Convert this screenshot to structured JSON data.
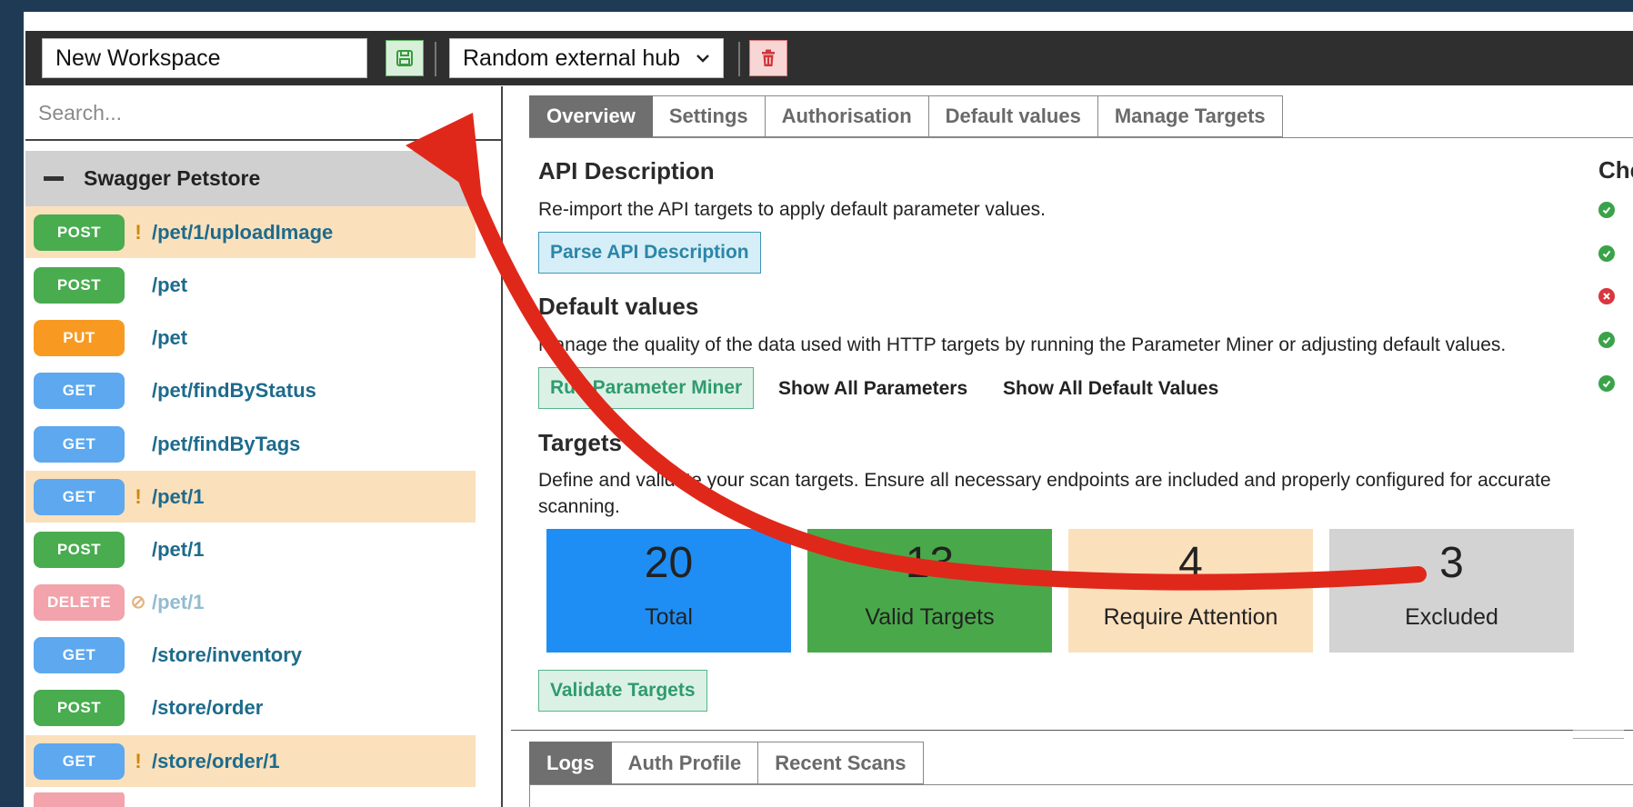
{
  "toolbar": {
    "workspace_name": "New Workspace",
    "hub_selected": "Random external hub"
  },
  "sidebar": {
    "search_placeholder": "Search...",
    "group_title": "Swagger Petstore",
    "endpoints": [
      {
        "method": "POST",
        "path": "/pet/1/uploadImage",
        "flag": "!"
      },
      {
        "method": "POST",
        "path": "/pet",
        "flag": ""
      },
      {
        "method": "PUT",
        "path": "/pet",
        "flag": ""
      },
      {
        "method": "GET",
        "path": "/pet/findByStatus",
        "flag": ""
      },
      {
        "method": "GET",
        "path": "/pet/findByTags",
        "flag": ""
      },
      {
        "method": "GET",
        "path": "/pet/1",
        "flag": "!"
      },
      {
        "method": "POST",
        "path": "/pet/1",
        "flag": ""
      },
      {
        "method": "DELETE",
        "path": "/pet/1",
        "flag": "⊘"
      },
      {
        "method": "GET",
        "path": "/store/inventory",
        "flag": ""
      },
      {
        "method": "POST",
        "path": "/store/order",
        "flag": ""
      },
      {
        "method": "GET",
        "path": "/store/order/1",
        "flag": "!"
      }
    ]
  },
  "tabs": [
    "Overview",
    "Settings",
    "Authorisation",
    "Default values",
    "Manage Targets"
  ],
  "api_description": {
    "heading": "API Description",
    "text": "Re-import the API targets to apply default parameter values.",
    "button": "Parse API Description"
  },
  "default_values": {
    "heading": "Default values",
    "text": "Manage the quality of the data used with HTTP targets by running the Parameter Miner or adjusting default values.",
    "button": "Run Parameter Miner",
    "link_params": "Show All Parameters",
    "link_defaults": "Show All Default Values"
  },
  "targets": {
    "heading": "Targets",
    "text": "Define and validate your scan targets. Ensure all necessary endpoints are included and properly configured for accurate scanning.",
    "stats": [
      {
        "value": "20",
        "label": "Total"
      },
      {
        "value": "13",
        "label": "Valid Targets"
      },
      {
        "value": "4",
        "label": "Require Attention"
      },
      {
        "value": "3",
        "label": "Excluded"
      }
    ],
    "validate_button": "Validate Targets"
  },
  "checks": {
    "title": "Che",
    "statuses": [
      "ok",
      "ok",
      "fail",
      "ok",
      "ok"
    ]
  },
  "bottom_tabs": [
    "Logs",
    "Auth Profile",
    "Recent Scans"
  ],
  "colors": {
    "annotation_arrow": "#e0281a",
    "post": "#49ac4f",
    "put": "#f89a22",
    "get": "#5da8ef",
    "delete": "#f2a3ab"
  }
}
